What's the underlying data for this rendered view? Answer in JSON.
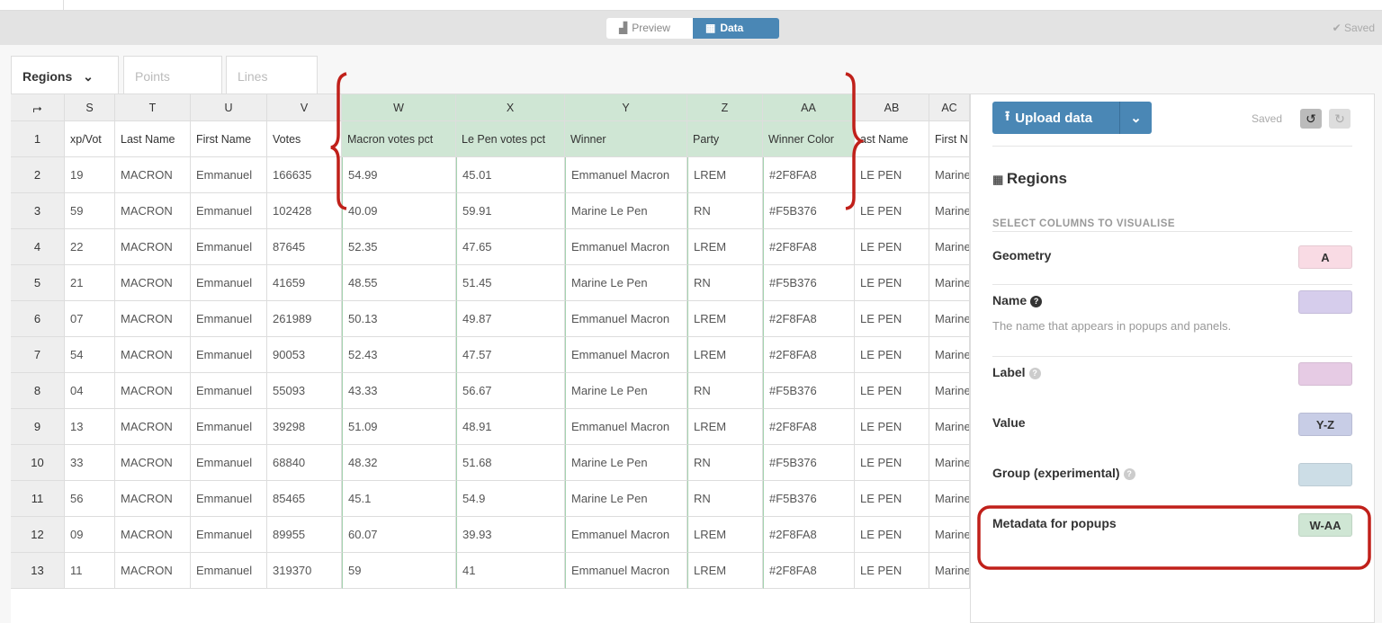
{
  "toolbar": {
    "preview": "Preview",
    "data": "Data",
    "saved": "✔ Saved"
  },
  "tabs": [
    {
      "label": "Regions",
      "active": true
    },
    {
      "label": "Points"
    },
    {
      "label": "Lines"
    }
  ],
  "sheet": {
    "columns": [
      "S",
      "T",
      "U",
      "V",
      "W",
      "X",
      "Y",
      "Z",
      "AA",
      "AB",
      "AC"
    ],
    "highlighted": [
      "W",
      "X",
      "Y",
      "Z",
      "AA"
    ],
    "headers": [
      "xp/Vot",
      "Last Name",
      "First Name",
      "Votes",
      "Macron votes pct",
      "Le Pen votes pct",
      "Winner",
      "Party",
      "Winner Color",
      "ast Name",
      "First N"
    ],
    "rows": [
      [
        "19",
        "MACRON",
        "Emmanuel",
        "166635",
        "54.99",
        "45.01",
        "Emmanuel Macron",
        "LREM",
        "#2F8FA8",
        "LE PEN",
        "Marine"
      ],
      [
        "59",
        "MACRON",
        "Emmanuel",
        "102428",
        "40.09",
        "59.91",
        "Marine Le Pen",
        "RN",
        "#F5B376",
        "LE PEN",
        "Marine"
      ],
      [
        "22",
        "MACRON",
        "Emmanuel",
        "87645",
        "52.35",
        "47.65",
        "Emmanuel Macron",
        "LREM",
        "#2F8FA8",
        "LE PEN",
        "Marine"
      ],
      [
        "21",
        "MACRON",
        "Emmanuel",
        "41659",
        "48.55",
        "51.45",
        "Marine Le Pen",
        "RN",
        "#F5B376",
        "LE PEN",
        "Marine"
      ],
      [
        "07",
        "MACRON",
        "Emmanuel",
        "261989",
        "50.13",
        "49.87",
        "Emmanuel Macron",
        "LREM",
        "#2F8FA8",
        "LE PEN",
        "Marine"
      ],
      [
        "54",
        "MACRON",
        "Emmanuel",
        "90053",
        "52.43",
        "47.57",
        "Emmanuel Macron",
        "LREM",
        "#2F8FA8",
        "LE PEN",
        "Marine"
      ],
      [
        "04",
        "MACRON",
        "Emmanuel",
        "55093",
        "43.33",
        "56.67",
        "Marine Le Pen",
        "RN",
        "#F5B376",
        "LE PEN",
        "Marine"
      ],
      [
        "13",
        "MACRON",
        "Emmanuel",
        "39298",
        "51.09",
        "48.91",
        "Emmanuel Macron",
        "LREM",
        "#2F8FA8",
        "LE PEN",
        "Marine"
      ],
      [
        "33",
        "MACRON",
        "Emmanuel",
        "68840",
        "48.32",
        "51.68",
        "Marine Le Pen",
        "RN",
        "#F5B376",
        "LE PEN",
        "Marine"
      ],
      [
        "56",
        "MACRON",
        "Emmanuel",
        "85465",
        "45.1",
        "54.9",
        "Marine Le Pen",
        "RN",
        "#F5B376",
        "LE PEN",
        "Marine"
      ],
      [
        "09",
        "MACRON",
        "Emmanuel",
        "89955",
        "60.07",
        "39.93",
        "Emmanuel Macron",
        "LREM",
        "#2F8FA8",
        "LE PEN",
        "Marine"
      ],
      [
        "11",
        "MACRON",
        "Emmanuel",
        "319370",
        "59",
        "41",
        "Emmanuel Macron",
        "LREM",
        "#2F8FA8",
        "LE PEN",
        "Marine"
      ]
    ]
  },
  "panel": {
    "upload": "Upload data",
    "saved": "Saved",
    "title": "Regions",
    "select_heading": "SELECT COLUMNS TO VISUALISE",
    "fields": [
      {
        "label": "Geometry",
        "value": "A",
        "color": "#f9dbe4"
      },
      {
        "label": "Name",
        "value": "",
        "color": "#d6cdec",
        "help": true,
        "desc": "The name that appears in popups and panels."
      },
      {
        "label": "Label",
        "value": "",
        "color": "#e6cbe4",
        "help": "light"
      },
      {
        "label": "Value",
        "value": "Y-Z",
        "color": "#c8cde6"
      },
      {
        "label": "Group (experimental)",
        "value": "",
        "color": "#ccdde6",
        "help": "light"
      },
      {
        "label": "Metadata for popups",
        "value": "W-AA",
        "color": "#cfe6d4"
      }
    ]
  },
  "colors": {
    "accent": "#4a87b5",
    "annotation": "#c0201a",
    "highlight": "#cfe6d4"
  }
}
